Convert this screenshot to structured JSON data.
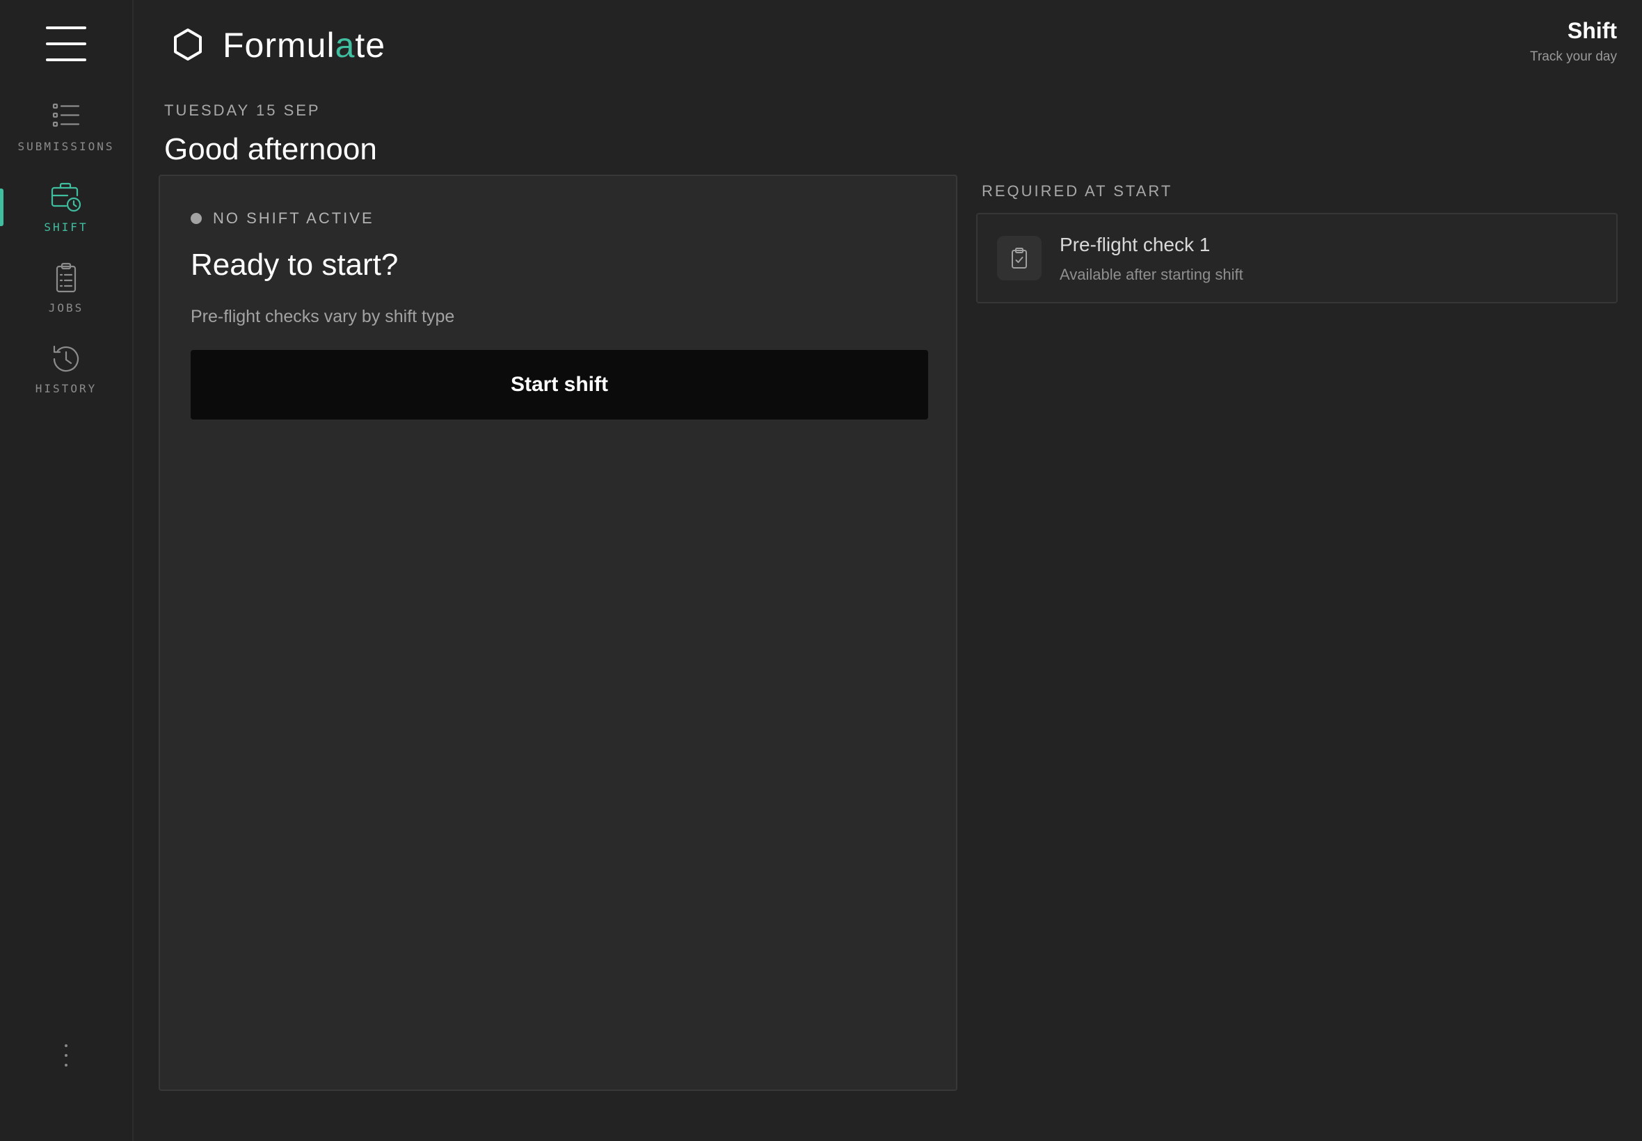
{
  "app": {
    "brand_prefix": "Formul",
    "brand_accent": "a",
    "brand_suffix": "te",
    "accent_color": "#3fbfa0"
  },
  "sidebar": {
    "items": [
      {
        "label": "SUBMISSIONS",
        "icon": "list-icon",
        "active": false
      },
      {
        "label": "SHIFT",
        "icon": "briefcase-clock-icon",
        "active": true
      },
      {
        "label": "JOBS",
        "icon": "clipboard-list-icon",
        "active": false
      },
      {
        "label": "HISTORY",
        "icon": "history-icon",
        "active": false
      }
    ]
  },
  "header": {
    "title": "Shift",
    "subtitle": "Track your day"
  },
  "date": "TUESDAY 15 SEP",
  "greeting": "Good afternoon",
  "shift_card": {
    "status": "NO SHIFT ACTIVE",
    "title": "Ready to start?",
    "subtitle": "Pre-flight checks vary by shift type",
    "button": "Start shift"
  },
  "required": {
    "label": "REQUIRED AT START",
    "items": [
      {
        "title": "Pre-flight check 1",
        "subtitle": "Available after starting shift",
        "icon": "clipboard-check-icon"
      }
    ]
  }
}
